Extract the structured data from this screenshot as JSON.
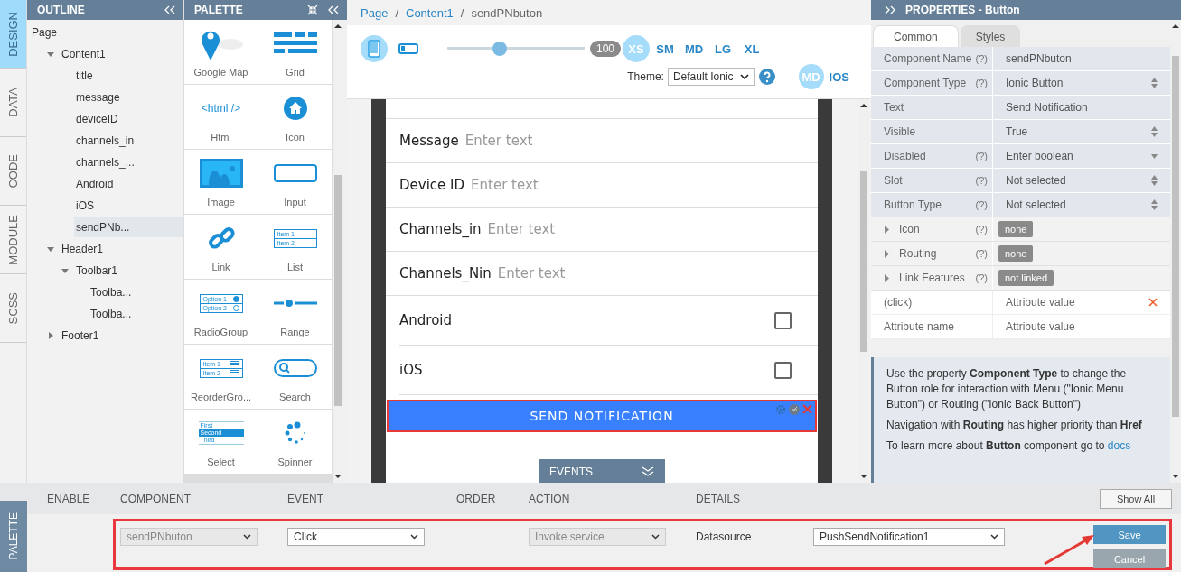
{
  "side_tabs": [
    {
      "label": "DESIGN",
      "selected": true
    },
    {
      "label": "DATA",
      "selected": false
    },
    {
      "label": "CODE",
      "selected": false
    },
    {
      "label": "MODULE",
      "selected": false
    },
    {
      "label": "SCSS",
      "selected": false
    }
  ],
  "outline": {
    "title": "OUTLINE",
    "tree": [
      {
        "label": "Page",
        "selected": false,
        "children": [
          {
            "label": "Content1",
            "selected": false,
            "expanded": true,
            "children": [
              {
                "label": "title",
                "selected": false
              },
              {
                "label": "message",
                "selected": false
              },
              {
                "label": "deviceID",
                "selected": false
              },
              {
                "label": "channels_in",
                "selected": false
              },
              {
                "label": "channels_...",
                "selected": false
              },
              {
                "label": "Android",
                "selected": false
              },
              {
                "label": "iOS",
                "selected": false
              },
              {
                "label": "sendPNb...",
                "selected": true
              }
            ]
          },
          {
            "label": "Header1",
            "selected": false,
            "expanded": true,
            "children": [
              {
                "label": "Toolbar1",
                "selected": false,
                "expanded": true,
                "children": [
                  {
                    "label": "Toolba...",
                    "selected": false
                  },
                  {
                    "label": "Toolba...",
                    "selected": false
                  }
                ]
              }
            ]
          },
          {
            "label": "Footer1",
            "selected": false,
            "expanded": false
          }
        ]
      }
    ]
  },
  "palette": {
    "title": "PALETTE",
    "items": [
      {
        "label": "Google Map",
        "kind": "map"
      },
      {
        "label": "Grid",
        "kind": "grid"
      },
      {
        "label": "Html",
        "kind": "html",
        "icon_texts": [
          "<html />"
        ]
      },
      {
        "label": "Icon",
        "kind": "icon"
      },
      {
        "label": "Image",
        "kind": "image"
      },
      {
        "label": "Input",
        "kind": "input"
      },
      {
        "label": "Link",
        "kind": "link"
      },
      {
        "label": "List",
        "kind": "list",
        "icon_texts": [
          "Item 1",
          "Item 2"
        ]
      },
      {
        "label": "RadioGroup",
        "kind": "radio",
        "icon_texts": [
          "Option 1",
          "Option 2"
        ]
      },
      {
        "label": "Range",
        "kind": "range"
      },
      {
        "label": "ReorderGro...",
        "kind": "reorder",
        "icon_texts": [
          "Item 1",
          "Item 2"
        ]
      },
      {
        "label": "Search",
        "kind": "search"
      },
      {
        "label": "Select",
        "kind": "select",
        "icon_texts": [
          "First",
          "Second",
          "Third"
        ]
      },
      {
        "label": "Spinner",
        "kind": "spinner"
      }
    ]
  },
  "breadcrumb": [
    {
      "label": "Page",
      "link": true
    },
    {
      "separator": "/",
      "label": "Content1",
      "link": true
    },
    {
      "separator": "/",
      "label": "sendPNbuton",
      "link": false
    }
  ],
  "toolbar": {
    "devices": [
      {
        "kind": "phone",
        "selected": true
      },
      {
        "kind": "tablet",
        "selected": false
      }
    ],
    "zoom": {
      "level": 0.38,
      "reading": "100"
    },
    "breakpoints": [
      {
        "label": "XS",
        "selected": true
      },
      {
        "label": "SM",
        "selected": false
      },
      {
        "label": "MD",
        "selected": false
      },
      {
        "label": "LG",
        "selected": false
      },
      {
        "label": "XL",
        "selected": false
      }
    ],
    "theme_label": "Theme:",
    "theme": "Default Ionic",
    "platforms": [
      {
        "label": "MD",
        "selected": true
      },
      {
        "label": "IOS",
        "selected": false
      }
    ]
  },
  "form": {
    "rows": [
      {
        "kind": "input",
        "label": "Message",
        "placeholder": "Enter text"
      },
      {
        "kind": "input",
        "label": "Device ID",
        "placeholder": "Enter text"
      },
      {
        "kind": "input",
        "label": "Channels_in",
        "placeholder": "Enter text"
      },
      {
        "kind": "input",
        "label": "Channels_Nin",
        "placeholder": "Enter text"
      },
      {
        "kind": "checkbox",
        "label": "Android",
        "checked": false
      },
      {
        "kind": "checkbox",
        "label": "iOS",
        "checked": false
      }
    ],
    "button": {
      "label": "SEND NOTIFICATION",
      "selected": true
    },
    "events_toggle": "EVENTS"
  },
  "properties": {
    "title": "PROPERTIES - Button",
    "tabs": [
      {
        "label": "Common",
        "selected": true
      },
      {
        "label": "Styles",
        "selected": false
      }
    ],
    "rows": [
      {
        "kind": "text",
        "label": "Component Name",
        "help": "(?)",
        "value": "sendPNbuton"
      },
      {
        "kind": "select",
        "label": "Component Type",
        "help": "(?)",
        "value": "Ionic Button"
      },
      {
        "kind": "text",
        "label": "Text",
        "value": "Send Notification"
      },
      {
        "kind": "select",
        "label": "Visible",
        "value": "True"
      },
      {
        "kind": "dropdown",
        "label": "Disabled",
        "help": "(?)",
        "value": "Enter boolean"
      },
      {
        "kind": "select",
        "label": "Slot",
        "help": "(?)",
        "value": "Not selected"
      },
      {
        "kind": "select",
        "label": "Button Type",
        "help": "(?)",
        "value": "Not selected"
      },
      {
        "kind": "group",
        "label": "Icon",
        "help": "(?)",
        "badge": "none",
        "expanded": false
      },
      {
        "kind": "group",
        "label": "Routing",
        "help": "(?)",
        "badge": "none",
        "expanded": false
      },
      {
        "kind": "group",
        "label": "Link Features",
        "help": "(?)",
        "badge": "not linked",
        "expanded": false
      },
      {
        "kind": "attribute",
        "name": "(click)",
        "value_placeholder": "Attribute value",
        "removable": true
      },
      {
        "kind": "attribute",
        "name_placeholder": "Attribute name",
        "value_placeholder": "Attribute value",
        "removable": false
      }
    ],
    "info": [
      "Use the property **Component Type** to change the Button role for interaction with Menu (\"Ionic Menu Button\") or Routing (\"Ionic Back Button\")",
      "Navigation with **Routing** has higher priority than **Href**",
      "To learn more about **Button** component go to "
    ],
    "info_link": "docs"
  },
  "events_panel": {
    "tab": "PALETTE",
    "columns": [
      "ENABLE",
      "COMPONENT",
      "EVENT",
      "ORDER",
      "ACTION",
      "DETAILS"
    ],
    "show_all": "Show All",
    "row": {
      "highlighted": true,
      "component": {
        "value": "sendPNbuton",
        "disabled": true
      },
      "event": {
        "value": "Click",
        "disabled": false
      },
      "action": {
        "value": "Invoke service",
        "disabled": true
      },
      "details_label": "Datasource",
      "details": {
        "value": "PushSendNotification1",
        "disabled": false
      }
    },
    "buttons": [
      {
        "label": "Save",
        "kind": "primary"
      },
      {
        "label": "Cancel",
        "kind": "secondary"
      }
    ]
  }
}
